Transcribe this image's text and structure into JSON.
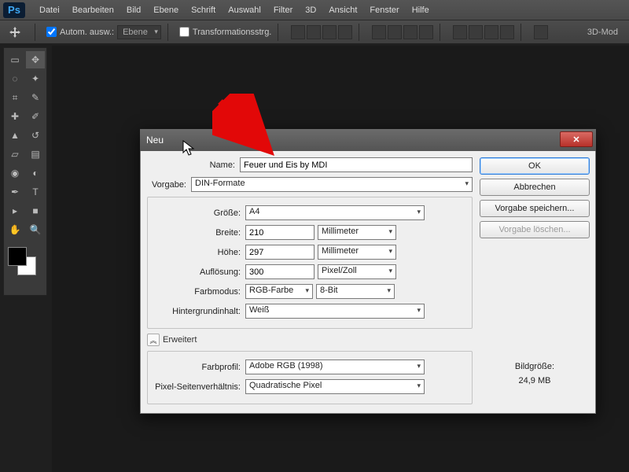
{
  "menu": {
    "logo": "Ps",
    "items": [
      "Datei",
      "Bearbeiten",
      "Bild",
      "Ebene",
      "Schrift",
      "Auswahl",
      "Filter",
      "3D",
      "Ansicht",
      "Fenster",
      "Hilfe"
    ]
  },
  "options": {
    "auto_select_label": "Autom. ausw.:",
    "auto_select_target": "Ebene",
    "transform_label": "Transformationsstrg.",
    "right_label": "3D-Mod"
  },
  "dialog": {
    "title": "Neu",
    "name_label": "Name:",
    "name_value": "Feuer und Eis by MDI",
    "preset_label": "Vorgabe:",
    "preset_value": "DIN-Formate",
    "size_label": "Größe:",
    "size_value": "A4",
    "width_label": "Breite:",
    "width_value": "210",
    "width_unit": "Millimeter",
    "height_label": "Höhe:",
    "height_value": "297",
    "height_unit": "Millimeter",
    "res_label": "Auflösung:",
    "res_value": "300",
    "res_unit": "Pixel/Zoll",
    "mode_label": "Farbmodus:",
    "mode_value": "RGB-Farbe",
    "mode_depth": "8-Bit",
    "bg_label": "Hintergrundinhalt:",
    "bg_value": "Weiß",
    "advanced_label": "Erweitert",
    "profile_label": "Farbprofil:",
    "profile_value": "Adobe RGB (1998)",
    "aspect_label": "Pixel-Seitenverhältnis:",
    "aspect_value": "Quadratische Pixel",
    "ok": "OK",
    "cancel": "Abbrechen",
    "save_preset": "Vorgabe speichern...",
    "del_preset": "Vorgabe löschen...",
    "imgsize_label": "Bildgröße:",
    "imgsize_value": "24,9 MB"
  }
}
